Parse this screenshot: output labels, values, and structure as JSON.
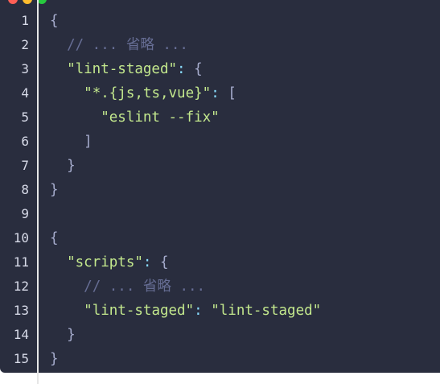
{
  "window": {
    "dots": [
      {
        "name": "close-dot",
        "color": "#ff5f56"
      },
      {
        "name": "minimize-dot",
        "color": "#ffbd2e"
      },
      {
        "name": "zoom-dot",
        "color": "#27c93f"
      }
    ]
  },
  "line_numbers": [
    "1",
    "2",
    "3",
    "4",
    "5",
    "6",
    "7",
    "8",
    "9",
    "10",
    "11",
    "12",
    "13",
    "14",
    "15"
  ],
  "code": {
    "l1": {
      "brace": "{"
    },
    "l2": {
      "comment": "// ... 省略 ..."
    },
    "l3": {
      "key": "\"lint-staged\"",
      "colon": ":",
      "brace": "{"
    },
    "l4": {
      "key": "\"*.{js,ts,vue}\"",
      "colon": ":",
      "bracket": "["
    },
    "l5": {
      "value": "\"eslint --fix\""
    },
    "l6": {
      "bracket": "]"
    },
    "l7": {
      "brace": "}"
    },
    "l8": {
      "brace": "}"
    },
    "l10": {
      "brace": "{"
    },
    "l11": {
      "key": "\"scripts\"",
      "colon": ":",
      "brace": "{"
    },
    "l12": {
      "comment": "// ... 省略 ..."
    },
    "l13": {
      "key": "\"lint-staged\"",
      "colon": ":",
      "value": "\"lint-staged\""
    },
    "l14": {
      "brace": "}"
    },
    "l15": {
      "brace": "}"
    }
  }
}
